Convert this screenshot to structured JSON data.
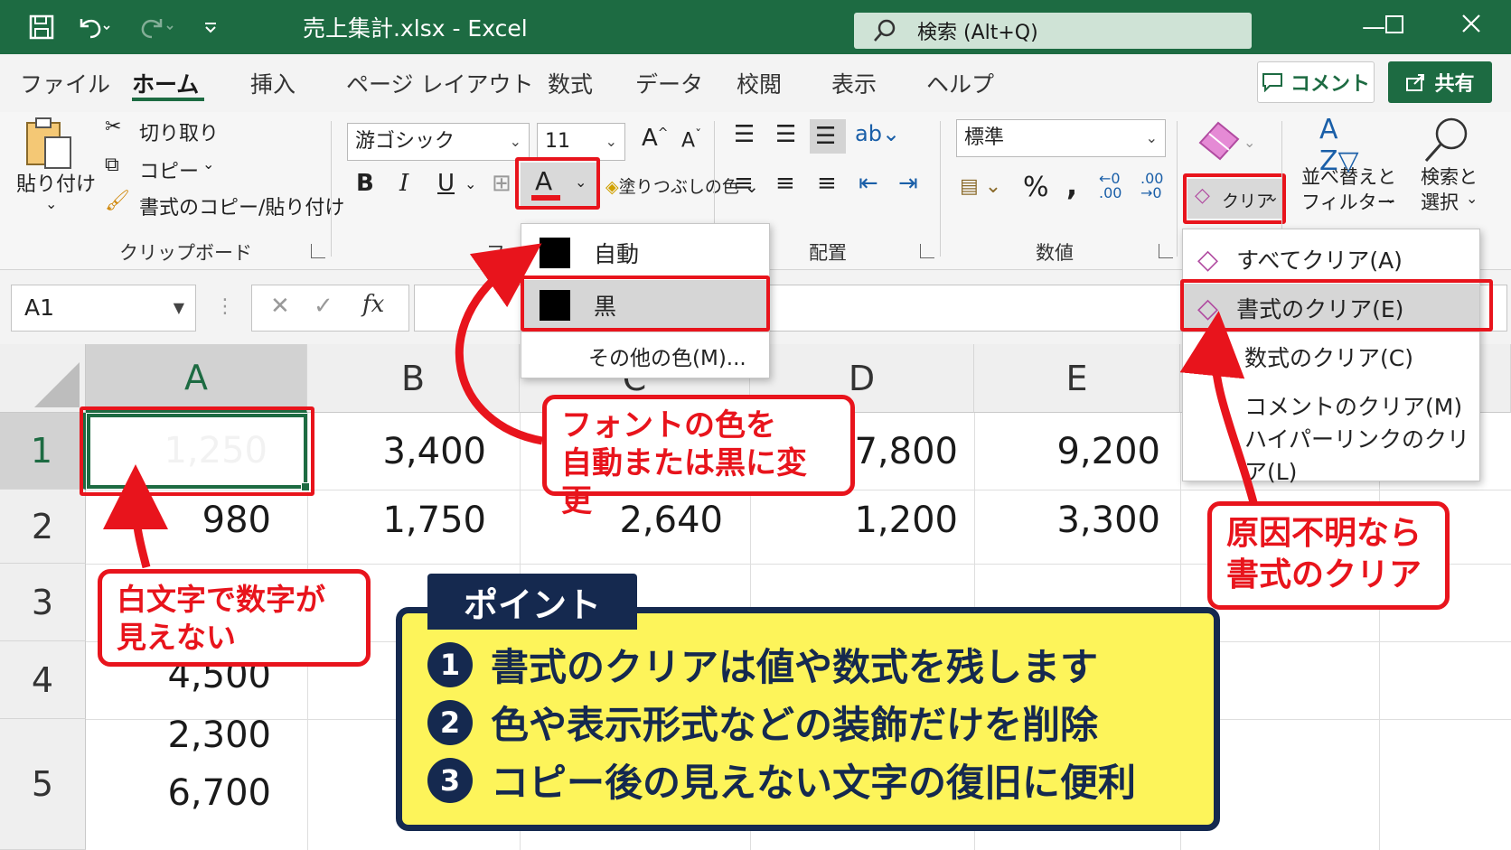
{
  "title_bar": {
    "title": "売上集計.xlsx  -  Excel",
    "search_placeholder": "検索 (Alt+Q)",
    "icons": [
      "save-icon",
      "undo-icon",
      "redo-icon",
      "customize-icon"
    ]
  },
  "tabs": [
    "ファイル",
    "ホーム",
    "挿入",
    "ページ レイアウト",
    "数式",
    "データ",
    "校閲",
    "表示",
    "ヘルプ"
  ],
  "active_tab": "ホーム",
  "comment_label": "コメント",
  "share_label": "共有",
  "ribbon": {
    "paste": "貼り付け",
    "cut": "切り取り",
    "copy": "コピー",
    "format_painter": "書式のコピー/貼り付け",
    "clipboard_group": "クリップボード",
    "font_name": "游ゴシック",
    "font_size": "11",
    "font_group": "フ",
    "font_color_letter": "A",
    "fill_color": "塗りつぶしの色",
    "align_group": "配置",
    "number_format": "標準",
    "number_group": "数値",
    "clear": "クリア",
    "sort_filter_1": "並べ替えと",
    "sort_filter_2": "フィルター",
    "find_select_1": "検索と",
    "find_select_2": "選択"
  },
  "formula_bar": {
    "name_box": "A1",
    "fx": "fx"
  },
  "columns": [
    "A",
    "B",
    "C",
    "D",
    "E"
  ],
  "rows": [
    "1",
    "2",
    "3",
    "4",
    "5"
  ],
  "cells": {
    "r1": {
      "A": "1,250",
      "B": "3,400",
      "D": "7,800",
      "E": "9,200"
    },
    "r2": {
      "A": "980",
      "B": "1,750",
      "C": "2,640",
      "D": "1,200",
      "E": "3,300"
    },
    "r4": {
      "A": "4,500"
    },
    "r5a": {
      "A": "2,300"
    },
    "r5b": {
      "A": "6,700"
    }
  },
  "font_color_menu": {
    "auto": "自動",
    "black": "黒",
    "more": "その他の色(M)..."
  },
  "clear_menu": [
    "すべてクリア(A)",
    "書式のクリア(E)",
    "数式のクリア(C)",
    "コメントのクリア(M)",
    "ハイパーリンクのクリア(L)"
  ],
  "callouts": {
    "white_text_1": "白文字で数字が",
    "white_text_2": "見えない",
    "font_color_1": "フォントの色を",
    "font_color_2": "自動または黒に変更",
    "unknown_1": "原因不明なら",
    "unknown_2": "書式のクリア"
  },
  "point": {
    "tag": "ポイント",
    "items": [
      {
        "num": "1",
        "text": "書式のクリアは値や数式を残します"
      },
      {
        "num": "2",
        "text": "色や表示形式などの装飾だけを削除"
      },
      {
        "num": "3",
        "text": "コピー後の見えない文字の復旧に便利"
      }
    ]
  },
  "colors": {
    "excel_green": "#1d6b42",
    "highlight_red": "#e8141c",
    "panel_yellow": "#fdf45a",
    "navy": "#15294f"
  }
}
